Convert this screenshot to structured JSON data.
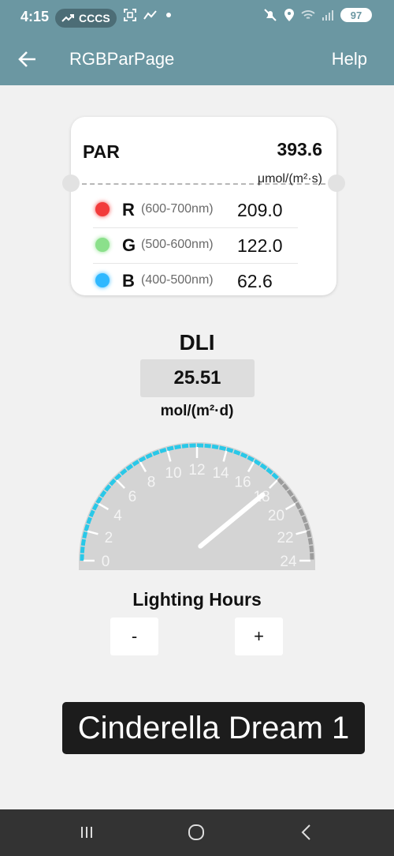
{
  "status_bar": {
    "time": "4:15",
    "pill_text": "CCCS",
    "battery": "97",
    "icons": [
      "trend-icon",
      "screenshot-icon",
      "activity-icon",
      "dot-icon",
      "mute-icon",
      "location-icon",
      "wifi-icon",
      "signal-icon",
      "battery-icon"
    ]
  },
  "app_bar": {
    "title": "RGBParPage",
    "help_label": "Help",
    "back_icon": "back-arrow-icon"
  },
  "par_card": {
    "label": "PAR",
    "value": "393.6",
    "unit": "μmol/(m²·s)",
    "rows": [
      {
        "channel": "R",
        "range": "(600-700nm)",
        "value": "209.0",
        "color": "#f23b3b"
      },
      {
        "channel": "G",
        "range": "(500-600nm)",
        "value": "122.0",
        "color": "#8be08b"
      },
      {
        "channel": "B",
        "range": "(400-500nm)",
        "value": "62.6",
        "color": "#2fb8ff"
      }
    ]
  },
  "dli": {
    "title": "DLI",
    "value": "25.51",
    "unit": "mol/(m²·d)"
  },
  "gauge": {
    "ticks": [
      "0",
      "2",
      "4",
      "6",
      "8",
      "10",
      "12",
      "14",
      "16",
      "18",
      "20",
      "22",
      "24"
    ],
    "min": 0,
    "max": 24,
    "value": 18,
    "active_color": "#29c8e8",
    "inactive_color": "#9c9c9c"
  },
  "lighting_hours": {
    "label": "Lighting Hours",
    "minus_label": "-",
    "plus_label": "+"
  },
  "device": {
    "name": "Cinderella Dream 1"
  },
  "nav_bar": {
    "icons": [
      "recent-apps-icon",
      "home-icon",
      "back-icon"
    ]
  }
}
